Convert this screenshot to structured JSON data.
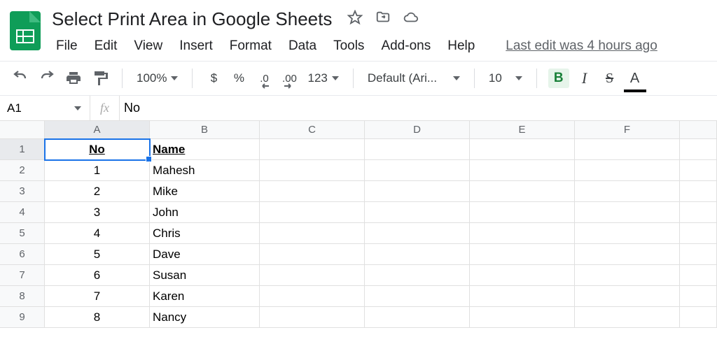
{
  "header": {
    "title": "Select Print Area in Google Sheets",
    "menus": [
      "File",
      "Edit",
      "View",
      "Insert",
      "Format",
      "Data",
      "Tools",
      "Add-ons",
      "Help"
    ],
    "last_edit": "Last edit was 4 hours ago"
  },
  "toolbar": {
    "zoom": "100%",
    "currency": "$",
    "percent": "%",
    "dec_less": ".0",
    "dec_more": ".00",
    "num_fmt": "123",
    "font": "Default (Ari...",
    "font_size": "10",
    "bold": "B",
    "italic": "I",
    "strike": "S",
    "color": "A"
  },
  "formula_bar": {
    "cell_ref": "A1",
    "fx": "fx",
    "value": "No"
  },
  "grid": {
    "columns": [
      "A",
      "B",
      "C",
      "D",
      "E",
      "F"
    ],
    "row_count": 9,
    "data": [
      {
        "no": "No",
        "name": "Name"
      },
      {
        "no": "1",
        "name": "Mahesh"
      },
      {
        "no": "2",
        "name": "Mike"
      },
      {
        "no": "3",
        "name": "John"
      },
      {
        "no": "4",
        "name": "Chris"
      },
      {
        "no": "5",
        "name": "Dave"
      },
      {
        "no": "6",
        "name": "Susan"
      },
      {
        "no": "7",
        "name": "Karen"
      },
      {
        "no": "8",
        "name": "Nancy"
      }
    ]
  }
}
